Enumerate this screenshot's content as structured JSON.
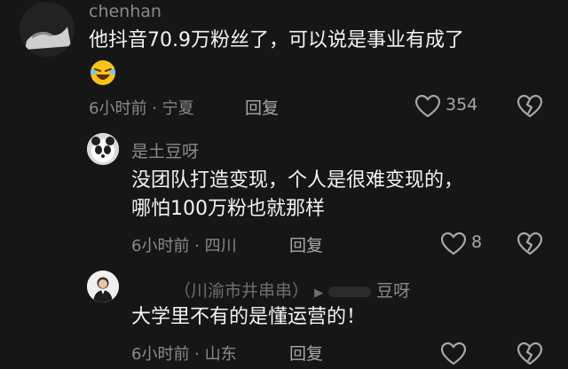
{
  "comment1": {
    "username": "chenhan",
    "text": "他抖音70.9万粉丝了，可以说是事业有成了",
    "time": "6小时前",
    "location": "宁夏",
    "reply_label": "回复",
    "like_count": "354"
  },
  "comment2": {
    "username": "是土豆呀",
    "text_line1": "没团队打造变现，个人是很难变现的，",
    "text_line2": "哪怕100万粉也就那样",
    "time": "6小时前",
    "location": "四川",
    "reply_label": "回复",
    "like_count": "8"
  },
  "comment3": {
    "username": "（川渝市井串串）",
    "reply_to": "豆呀",
    "text": "大学里不有的是懂运营的！",
    "time": "6小时前",
    "location": "山东",
    "reply_label": "回复"
  },
  "separator": " · "
}
